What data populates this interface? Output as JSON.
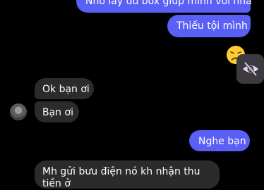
{
  "messages": [
    {
      "id": "b1",
      "direction": "sent",
      "text": "Nhờ lấy đủ box giúp mình với nha"
    },
    {
      "id": "b2",
      "direction": "sent",
      "text": "Thiếu tội mình"
    },
    {
      "id": "b3",
      "direction": "received",
      "text": "Ok bạn ơi"
    },
    {
      "id": "b4",
      "direction": "received",
      "text": "Bạn ơi"
    },
    {
      "id": "b5",
      "direction": "sent",
      "text": "Nghe bạn"
    },
    {
      "id": "b6",
      "direction": "received",
      "text": "Mh gửi bưu điện nó kh nhận thu tiền ở"
    }
  ],
  "reaction": {
    "icon": "disappointed-face-emoji"
  },
  "hide_button": {
    "icon": "eye-slash-icon"
  },
  "colors": {
    "sent": "#5a5ff5",
    "received": "#2b2b2b",
    "background": "#000000"
  }
}
